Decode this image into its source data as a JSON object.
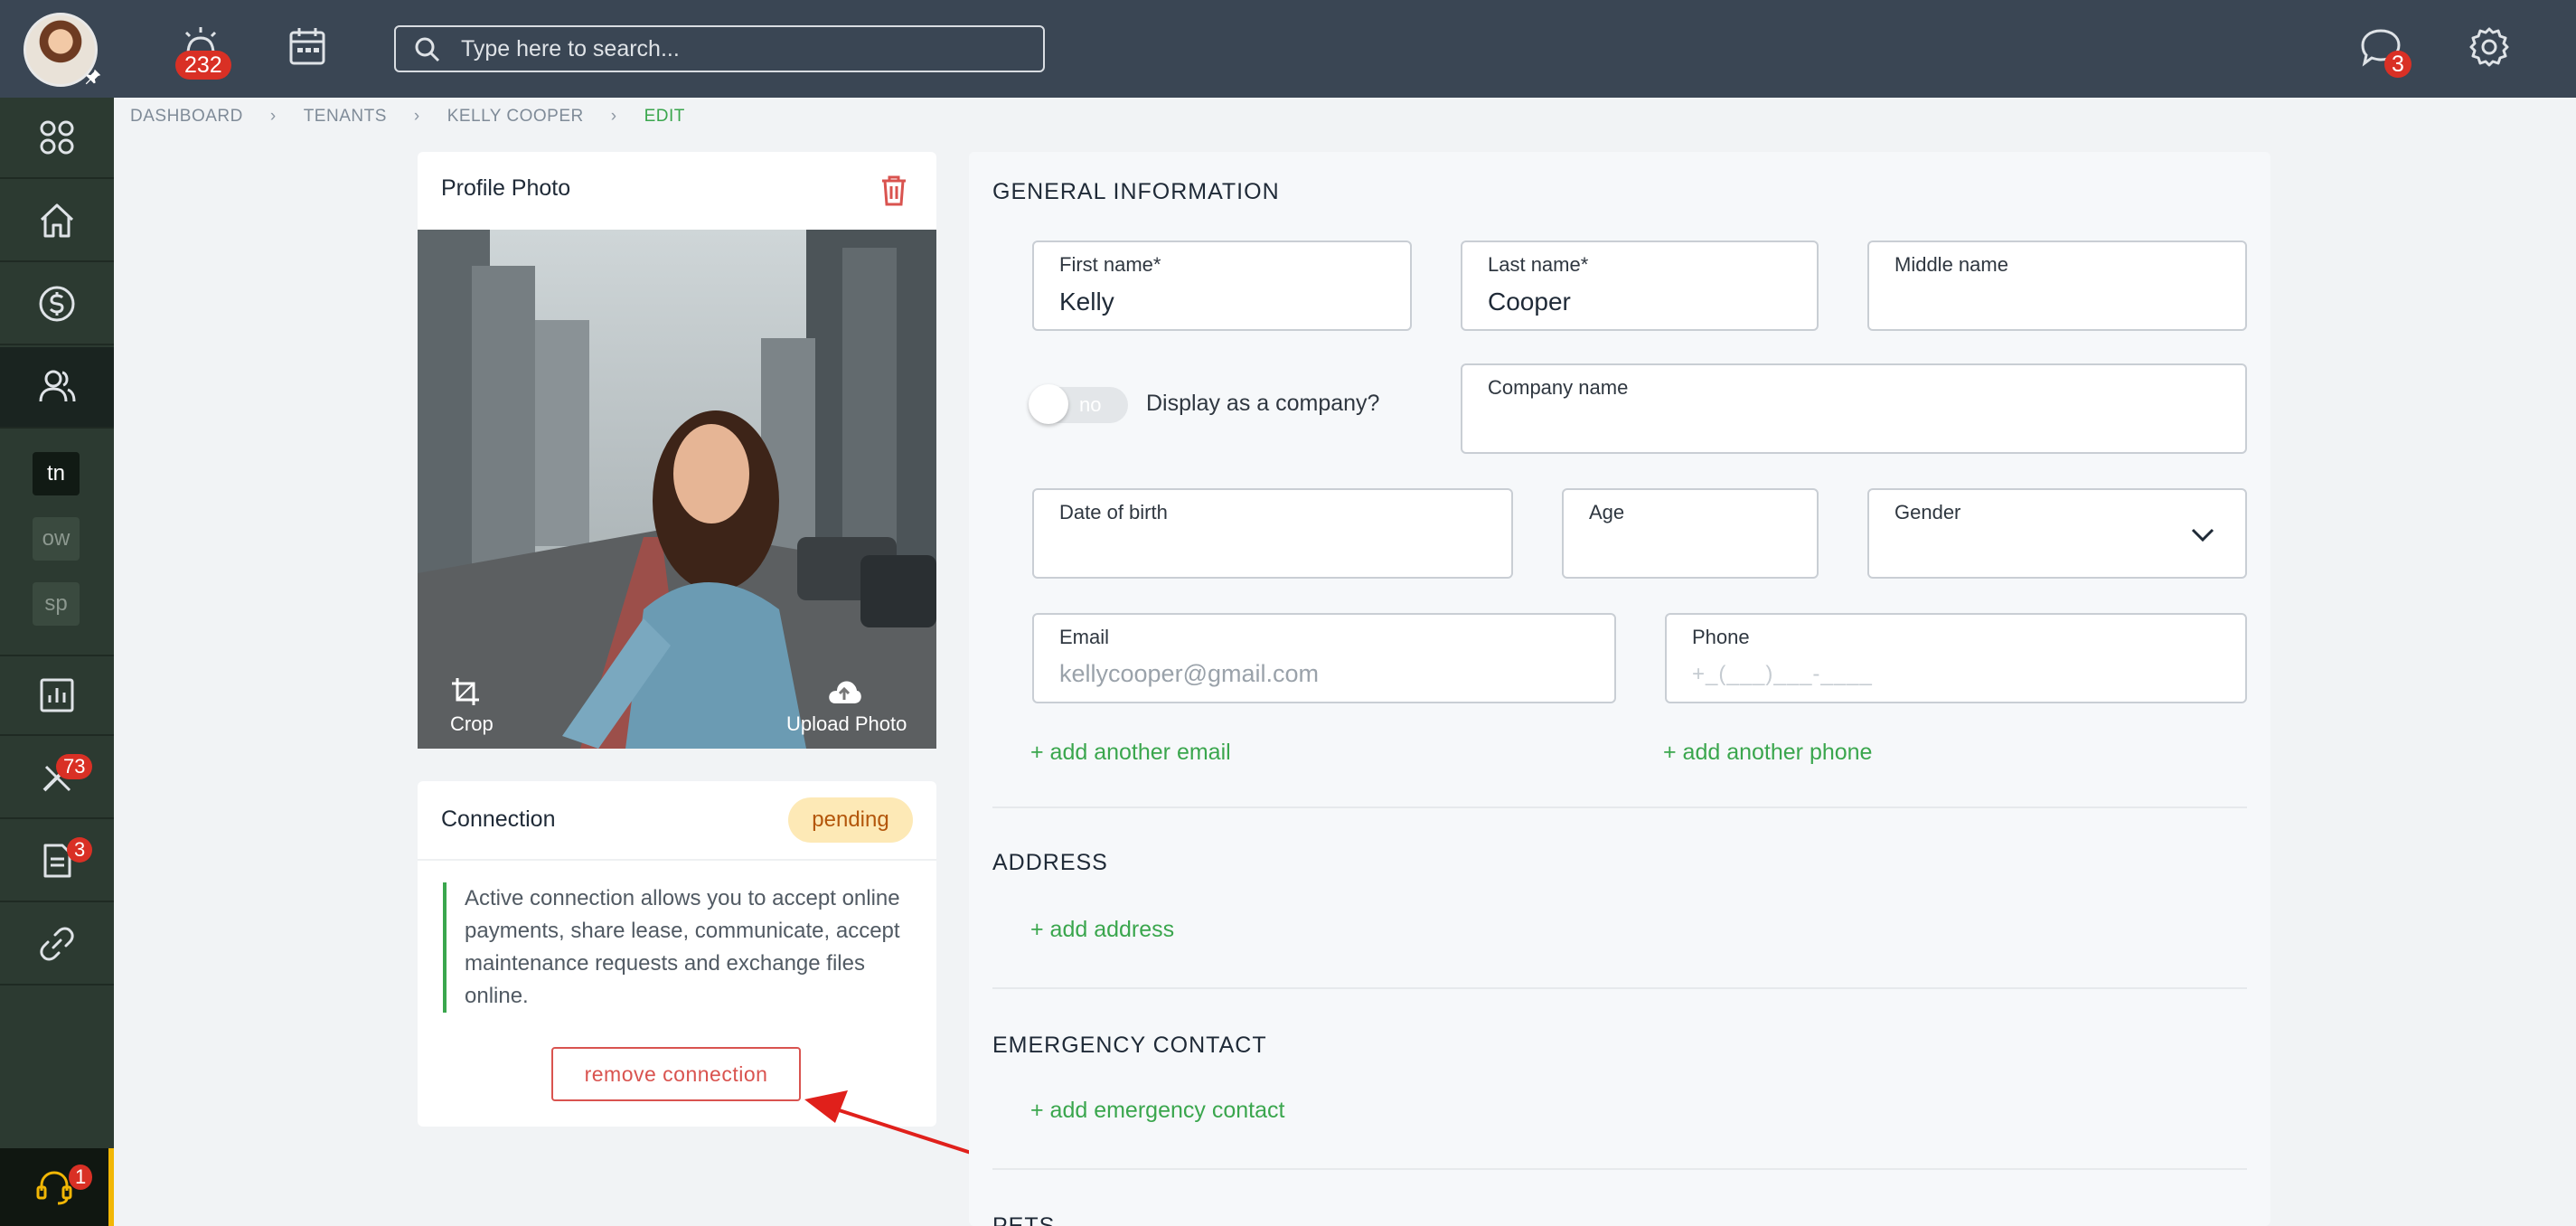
{
  "topbar": {
    "notifications_count": "232",
    "chat_count": "3",
    "search_placeholder": "Type here to search..."
  },
  "sidebar": {
    "mini_items": [
      "tn",
      "ow",
      "sp"
    ],
    "maintenance_badge": "73",
    "documents_badge": "3",
    "support_badge": "1"
  },
  "breadcrumb": [
    "DASHBOARD",
    "TENANTS",
    "KELLY COOPER",
    "EDIT"
  ],
  "profile_photo": {
    "title": "Profile Photo",
    "crop_label": "Crop",
    "upload_label": "Upload Photo"
  },
  "connection": {
    "title": "Connection",
    "status": "pending",
    "description": "Active connection allows you to accept online payments, share lease, communicate, accept maintenance requests and exchange files online.",
    "remove_label": "remove connection"
  },
  "general": {
    "title": "GENERAL INFORMATION",
    "first_name_label": "First name*",
    "first_name_value": "Kelly",
    "last_name_label": "Last name*",
    "last_name_value": "Cooper",
    "middle_name_label": "Middle name",
    "toggle_text": "no",
    "display_company_label": "Display as a company?",
    "company_name_label": "Company name",
    "dob_label": "Date of birth",
    "age_label": "Age",
    "gender_label": "Gender",
    "email_label": "Email",
    "email_placeholder": "kellycooper@gmail.com",
    "phone_label": "Phone",
    "phone_placeholder": "+_(___)___-____",
    "add_email": "+ add another email",
    "add_phone": "+ add another phone"
  },
  "address": {
    "title": "ADDRESS",
    "add": "+ add address"
  },
  "emergency": {
    "title": "EMERGENCY CONTACT",
    "add": "+ add emergency contact"
  },
  "pets": {
    "title": "PETS"
  },
  "colors": {
    "accent_green": "#3aa64d",
    "danger_red": "#d9534f",
    "topbar": "#3a4654",
    "sidebar": "#2c3a31"
  }
}
